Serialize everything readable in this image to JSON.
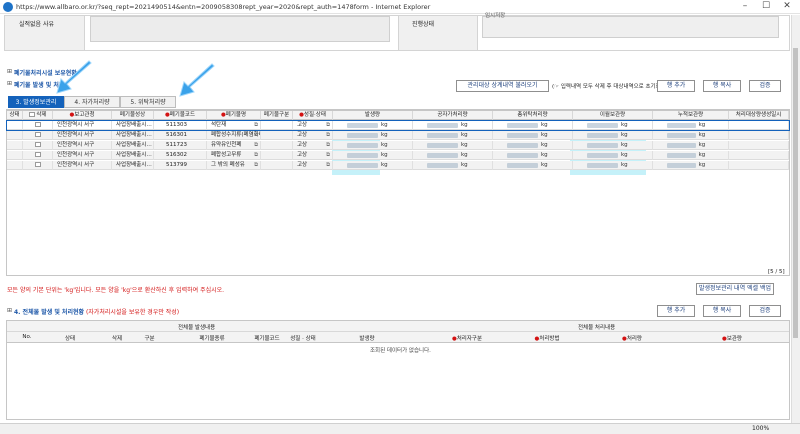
{
  "window": {
    "title": "https://www.allbaro.or.kr/?seq_rept=2021490514&entn=2009058308rept_year=2020&rept_auth=1478form - Internet Explorer",
    "zoom": "100%"
  },
  "top_form": {
    "reason_label": "실적없음 사유",
    "status_label": "진행상태",
    "status_value": "임시저장"
  },
  "sections": {
    "facility_title": "폐기물처리시설 보유현황",
    "generation_title": "폐기물 발생 및 처리",
    "generation_buttons": {
      "import": "관리대상 상계내역 불러오기",
      "note": "(☞ 입력내역 모두 삭제 후 대상내역으로 초기화)",
      "add_row": "행 추가",
      "copy_row": "행 복사",
      "validate": "검증"
    },
    "tabs": [
      {
        "label": "3. 발생정보관리"
      },
      {
        "label": "4. 자가처리량"
      },
      {
        "label": "5. 위탁처리량"
      }
    ]
  },
  "grid": {
    "columns": [
      "상태",
      "삭제",
      "보고관청",
      "폐기물성상",
      "폐기물코드",
      "폐기물명",
      "폐기물구분",
      "성질·상태",
      "발생량",
      "공자가처리량",
      "총위탁처리량",
      "이월보관량",
      "누적보관량",
      "처리대상량생성일시"
    ],
    "required": [
      false,
      false,
      true,
      false,
      true,
      true,
      false,
      true,
      false,
      false,
      false,
      false,
      false,
      false
    ],
    "unit": "kg",
    "rows": [
      {
        "region": "인천광역시 서구",
        "type": "사업장배출시…",
        "code": "511303",
        "name": "석탄재",
        "state": "고상"
      },
      {
        "region": "인천광역시 서구",
        "type": "사업장배출시…",
        "code": "516301",
        "name": "폐합성수지류(폐염화비닐…",
        "state": "고상"
      },
      {
        "region": "인천광역시 서구",
        "type": "사업장배출시…",
        "code": "511723",
        "name": "유약유인천폐",
        "state": "고상"
      },
      {
        "region": "인천광역시 서구",
        "type": "사업장배출시…",
        "code": "516302",
        "name": "폐합성고무류",
        "state": "고상"
      },
      {
        "region": "인천광역시 서구",
        "type": "사업장배출시…",
        "code": "513799",
        "name": "그 밖의 폐성유",
        "state": "고상"
      }
    ],
    "count": "[5 / 5]"
  },
  "notice": "모든 양의 기본 단위는 'kg'입니다. 모든 양을 'kg'으로 환산하신 후 입력하여 주십시오.",
  "storage_button": "발생정보관리 내역 엑셀 백업",
  "section4": {
    "title_prefix": "4. 전체물 발생 및 처리현황",
    "title_note": "(자가처리시설을 보유한 경우만 작성)",
    "add_row": "행 추가",
    "copy_row": "행 복사",
    "validate": "검증",
    "group_left": "전체물 발생내용",
    "group_right": "전체물 처리내용",
    "columns": [
      "No.",
      "상태",
      "삭제",
      "구분",
      "폐기물종류",
      "폐기물코드",
      "성질 · 상태",
      "발생량",
      "처리자구분",
      "처리방법",
      "처리량",
      "보관량"
    ],
    "empty": "조회된 데이터가 없습니다."
  }
}
